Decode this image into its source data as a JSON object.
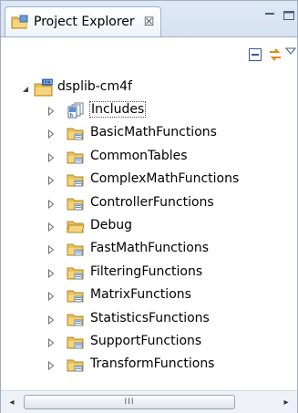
{
  "view": {
    "title": "Project Explorer",
    "close_glyph": "☒"
  },
  "toolbar": {
    "collapse_all": "collapse-all-icon",
    "link_with_editor": "link-with-editor-icon",
    "view_menu": "view-menu-icon"
  },
  "tree": {
    "root": {
      "label": "dsplib-cm4f",
      "expanded": true
    },
    "children": [
      {
        "label": "Includes",
        "icon": "includes-icon"
      },
      {
        "label": "BasicMathFunctions",
        "icon": "source-folder-icon"
      },
      {
        "label": "CommonTables",
        "icon": "source-folder-icon"
      },
      {
        "label": "ComplexMathFunctions",
        "icon": "source-folder-icon"
      },
      {
        "label": "ControllerFunctions",
        "icon": "source-folder-icon"
      },
      {
        "label": "Debug",
        "icon": "folder-icon"
      },
      {
        "label": "FastMathFunctions",
        "icon": "source-folder-icon"
      },
      {
        "label": "FilteringFunctions",
        "icon": "source-folder-icon"
      },
      {
        "label": "MatrixFunctions",
        "icon": "source-folder-icon"
      },
      {
        "label": "StatisticsFunctions",
        "icon": "source-folder-icon"
      },
      {
        "label": "SupportFunctions",
        "icon": "source-folder-icon"
      },
      {
        "label": "TransformFunctions",
        "icon": "source-folder-icon"
      }
    ]
  },
  "scrollbar": {
    "left_arrow": "◂",
    "right_arrow": "▸",
    "grip": "III"
  },
  "colors": {
    "header_bg": "#dfe8f5",
    "border": "#9eb2cd",
    "folder": "#e8c15a"
  }
}
